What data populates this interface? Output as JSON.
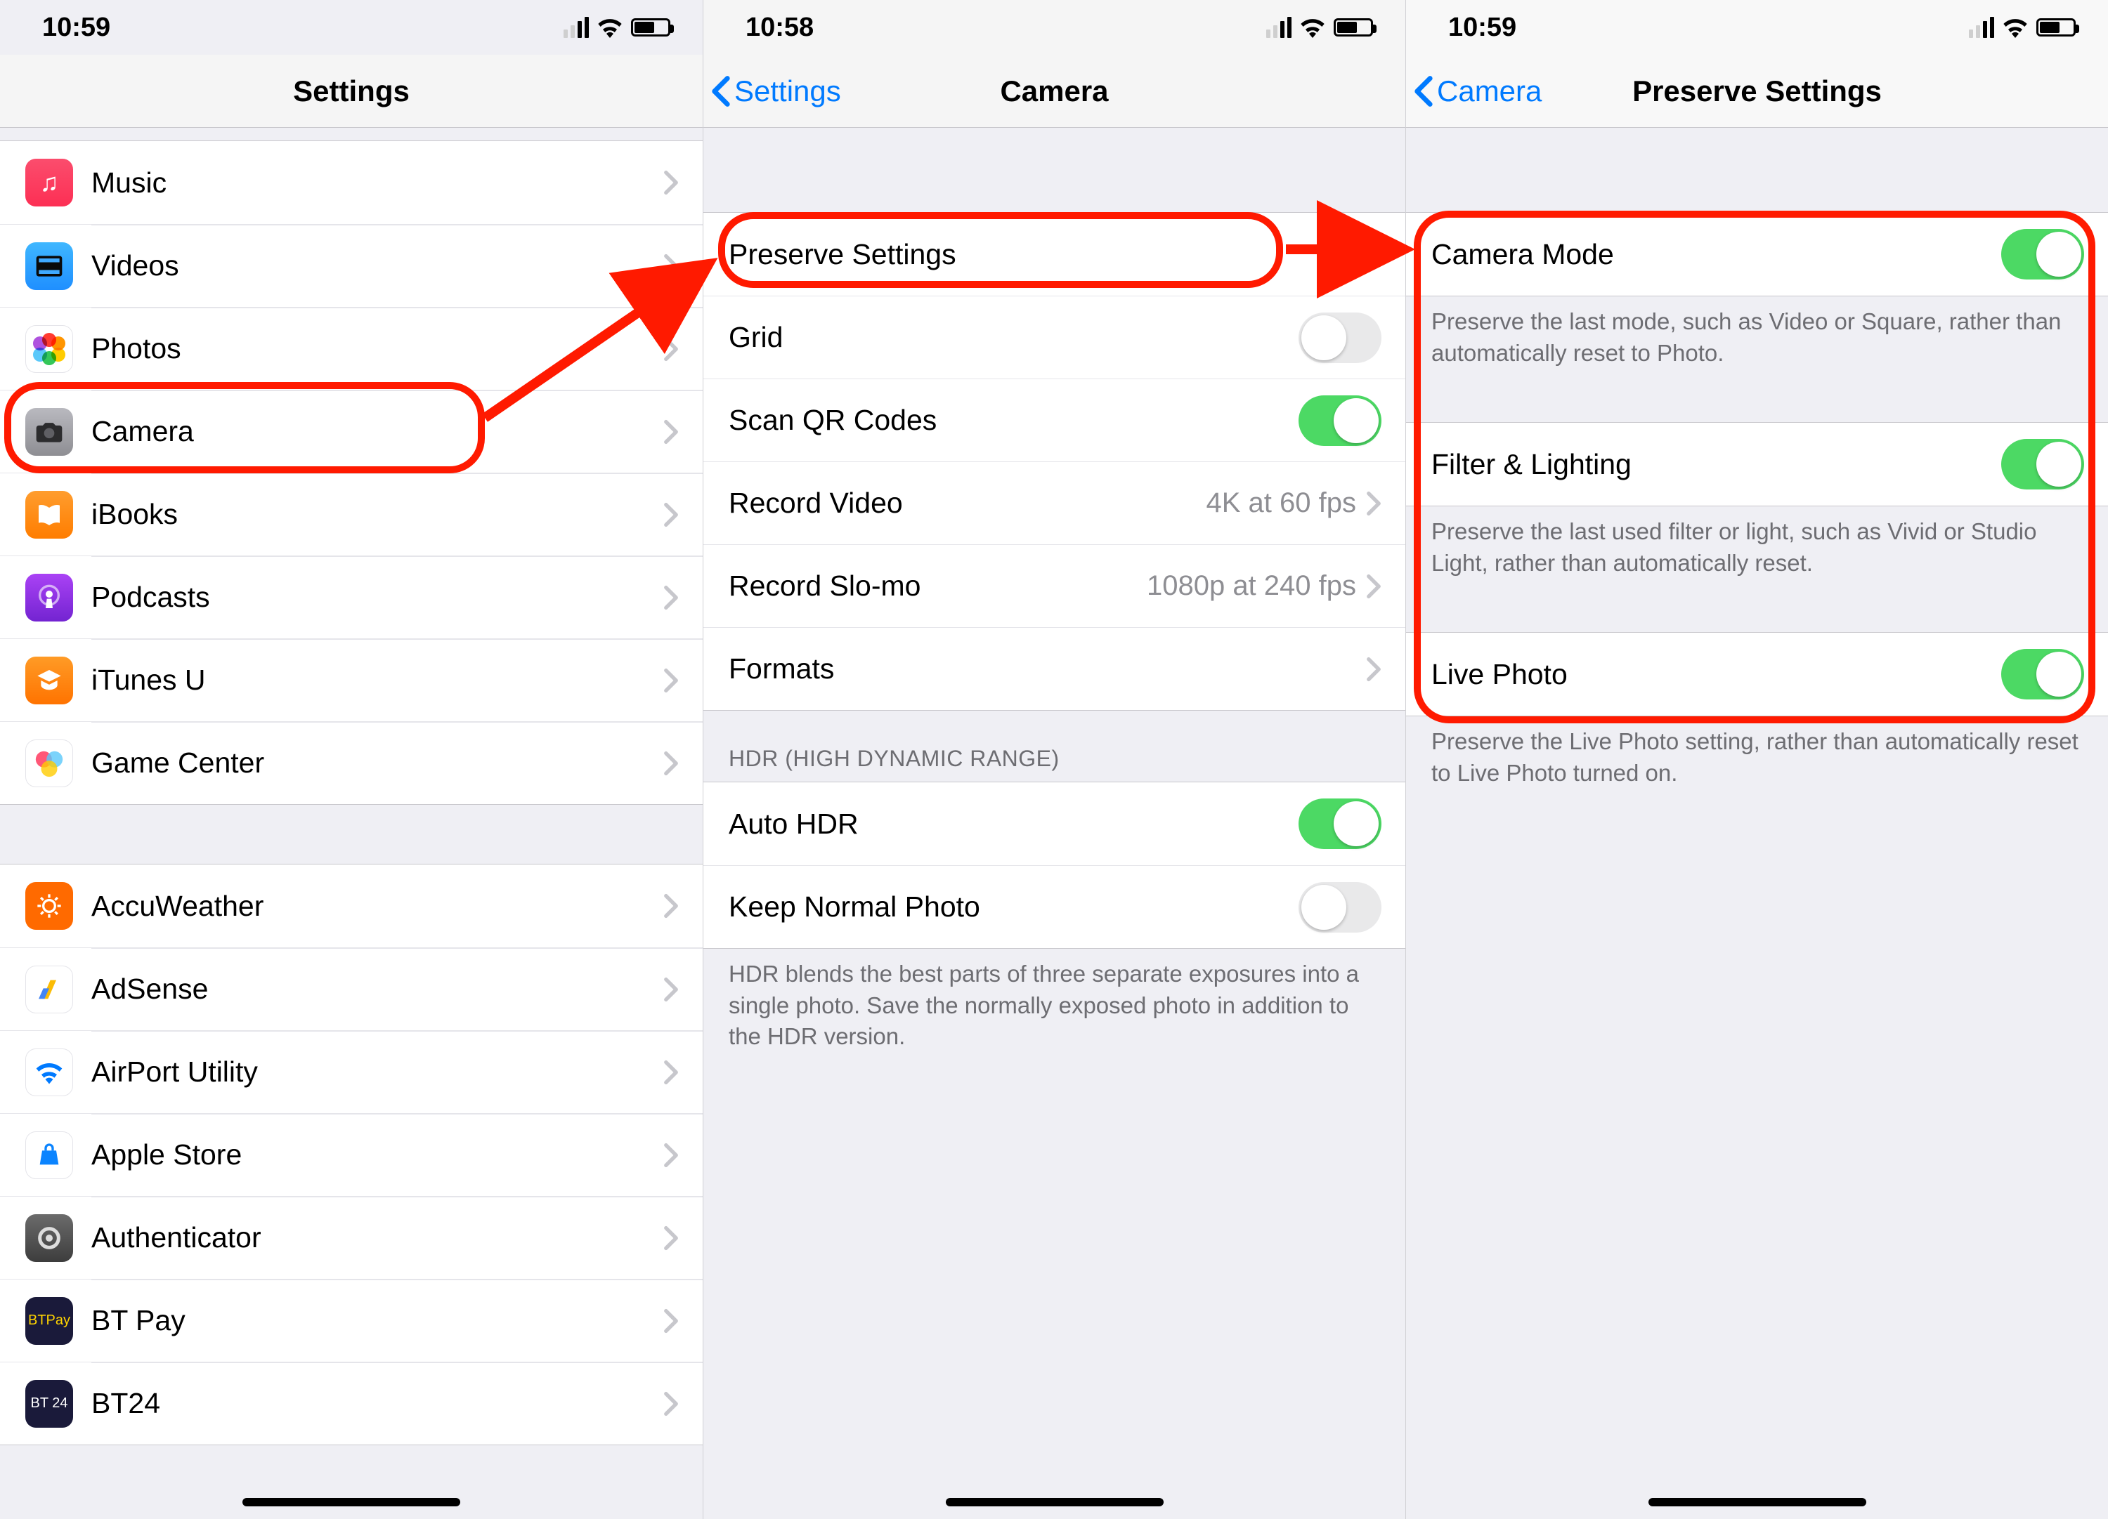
{
  "screen1": {
    "time": "10:59",
    "title": "Settings",
    "group1": [
      {
        "icon": "music-icon",
        "label": "Music"
      },
      {
        "icon": "videos-icon",
        "label": "Videos"
      },
      {
        "icon": "photos-icon",
        "label": "Photos"
      },
      {
        "icon": "camera-icon",
        "label": "Camera"
      },
      {
        "icon": "ibooks-icon",
        "label": "iBooks"
      },
      {
        "icon": "podcasts-icon",
        "label": "Podcasts"
      },
      {
        "icon": "itunesu-icon",
        "label": "iTunes U"
      },
      {
        "icon": "gamecenter-icon",
        "label": "Game Center"
      }
    ],
    "group2": [
      {
        "icon": "accuweather-icon",
        "label": "AccuWeather"
      },
      {
        "icon": "adsense-icon",
        "label": "AdSense"
      },
      {
        "icon": "airport-icon",
        "label": "AirPort Utility"
      },
      {
        "icon": "applestore-icon",
        "label": "Apple Store"
      },
      {
        "icon": "authenticator-icon",
        "label": "Authenticator"
      },
      {
        "icon": "btpay-icon",
        "label": "BT Pay"
      },
      {
        "icon": "bt24-icon",
        "label": "BT24"
      }
    ]
  },
  "screen2": {
    "time": "10:58",
    "back": "Settings",
    "title": "Camera",
    "rows": {
      "preserve": "Preserve Settings",
      "grid": "Grid",
      "scanqr": "Scan QR Codes",
      "recvideo": "Record Video",
      "recvideo_val": "4K at 60 fps",
      "recslomo": "Record Slo-mo",
      "recslomo_val": "1080p at 240 fps",
      "formats": "Formats"
    },
    "hdr_header": "HDR (HIGH DYNAMIC RANGE)",
    "hdr_rows": {
      "auto": "Auto HDR",
      "keep": "Keep Normal Photo"
    },
    "hdr_footer": "HDR blends the best parts of three separate exposures into a single photo. Save the normally exposed photo in addition to the HDR version."
  },
  "screen3": {
    "time": "10:59",
    "back": "Camera",
    "title": "Preserve Settings",
    "rows": {
      "mode": "Camera Mode",
      "mode_footer": "Preserve the last mode, such as Video or Square, rather than automatically reset to Photo.",
      "filter": "Filter & Lighting",
      "filter_footer": "Preserve the last used filter or light, such as Vivid or Studio Light, rather than automatically reset.",
      "live": "Live Photo",
      "live_footer": "Preserve the Live Photo setting, rather than automatically reset to Live Photo turned on."
    }
  },
  "toggles": {
    "grid": false,
    "scanqr": true,
    "autohdr": true,
    "keepnormal": false,
    "cameramode": true,
    "filter": true,
    "livephoto": true
  }
}
